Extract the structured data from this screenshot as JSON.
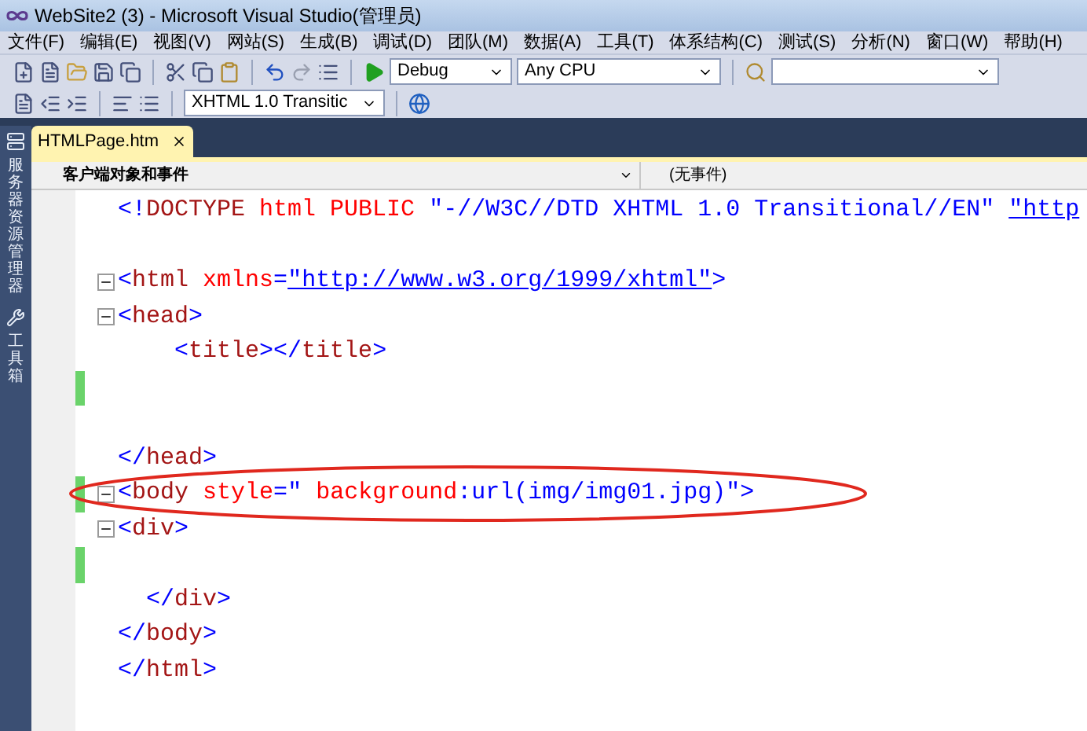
{
  "window": {
    "title": "WebSite2 (3) - Microsoft Visual Studio(管理员)"
  },
  "menu": [
    "文件(F)",
    "编辑(E)",
    "视图(V)",
    "网站(S)",
    "生成(B)",
    "调试(D)",
    "团队(M)",
    "数据(A)",
    "工具(T)",
    "体系结构(C)",
    "测试(S)",
    "分析(N)",
    "窗口(W)",
    "帮助(H)"
  ],
  "toolbar": {
    "configuration": "Debug",
    "platform": "Any CPU",
    "doctype": "XHTML 1.0 Transitic"
  },
  "sidebar": {
    "items": [
      "服务器资源管理器",
      "工具箱"
    ]
  },
  "tabs": [
    {
      "label": "HTMLPage.htm",
      "selected": true
    }
  ],
  "navigation": {
    "objects": "客户端对象和事件",
    "events": "(无事件)"
  },
  "code": [
    {
      "kind": "plain",
      "fold": false,
      "changed": false,
      "tokens": [
        {
          "kind": "punct",
          "text": "<!"
        },
        {
          "kind": "tag",
          "text": "DOCTYPE"
        },
        {
          "kind": "attr",
          "text": " html PUBLIC "
        },
        {
          "kind": "value",
          "text": "\"-//W3C//DTD XHTML 1.0 Transitional//EN\" "
        },
        {
          "kind": "link",
          "text": "\"http"
        }
      ]
    },
    {
      "fold": false,
      "changed": false
    },
    {
      "kind": "plain",
      "fold": true,
      "changed": false,
      "tokens": [
        {
          "kind": "punct",
          "text": "<"
        },
        {
          "kind": "tag",
          "text": "html"
        },
        {
          "kind": "attr",
          "text": " xmlns"
        },
        {
          "kind": "punct",
          "text": "="
        },
        {
          "kind": "link",
          "text": "\"http://www.w3.org/1999/xhtml\""
        },
        {
          "kind": "punct",
          "text": ">"
        }
      ]
    },
    {
      "kind": "plain",
      "fold": true,
      "changed": false,
      "tokens": [
        {
          "kind": "punct",
          "text": "<"
        },
        {
          "kind": "tag",
          "text": "head"
        },
        {
          "kind": "punct",
          "text": ">"
        }
      ]
    },
    {
      "kind": "indented",
      "fold": false,
      "changed": false,
      "tokens": [
        {
          "kind": "punct",
          "text": "<"
        },
        {
          "kind": "tag",
          "text": "title"
        },
        {
          "kind": "punct",
          "text": "></"
        },
        {
          "kind": "tag",
          "text": "title"
        },
        {
          "kind": "punct",
          "text": ">"
        }
      ]
    },
    {
      "fold": false,
      "changed": true
    },
    {
      "fold": false,
      "changed": false
    },
    {
      "kind": "plain",
      "fold": false,
      "changed": false,
      "tokens": [
        {
          "kind": "punct",
          "text": "</"
        },
        {
          "kind": "tag",
          "text": "head"
        },
        {
          "kind": "punct",
          "text": ">"
        }
      ]
    },
    {
      "kind": "plain",
      "fold": true,
      "changed": true,
      "tokens": [
        {
          "kind": "punct",
          "text": "<"
        },
        {
          "kind": "tag",
          "text": "body"
        },
        {
          "kind": "attr",
          "text": " style"
        },
        {
          "kind": "punct",
          "text": "="
        },
        {
          "kind": "value",
          "text": "\" "
        },
        {
          "kind": "attr",
          "text": "background"
        },
        {
          "kind": "value",
          "text": ":url(img/img01.jpg)\""
        },
        {
          "kind": "punct",
          "text": ">"
        }
      ]
    },
    {
      "kind": "plain",
      "fold": true,
      "changed": false,
      "tokens": [
        {
          "kind": "punct",
          "text": "<"
        },
        {
          "kind": "tag",
          "text": "div"
        },
        {
          "kind": "punct",
          "text": ">"
        }
      ]
    },
    {
      "fold": false,
      "changed": true
    },
    {
      "kind": "offset",
      "fold": false,
      "changed": false,
      "tokens": [
        {
          "kind": "punct",
          "text": "</"
        },
        {
          "kind": "tag",
          "text": "div"
        },
        {
          "kind": "punct",
          "text": ">"
        }
      ]
    },
    {
      "kind": "plain",
      "fold": false,
      "changed": false,
      "tokens": [
        {
          "kind": "punct",
          "text": "</"
        },
        {
          "kind": "tag",
          "text": "body"
        },
        {
          "kind": "punct",
          "text": ">"
        }
      ]
    },
    {
      "kind": "plain",
      "fold": false,
      "changed": false,
      "tokens": [
        {
          "kind": "punct",
          "text": "</"
        },
        {
          "kind": "tag",
          "text": "html"
        },
        {
          "kind": "punct",
          "text": ">"
        }
      ]
    }
  ]
}
